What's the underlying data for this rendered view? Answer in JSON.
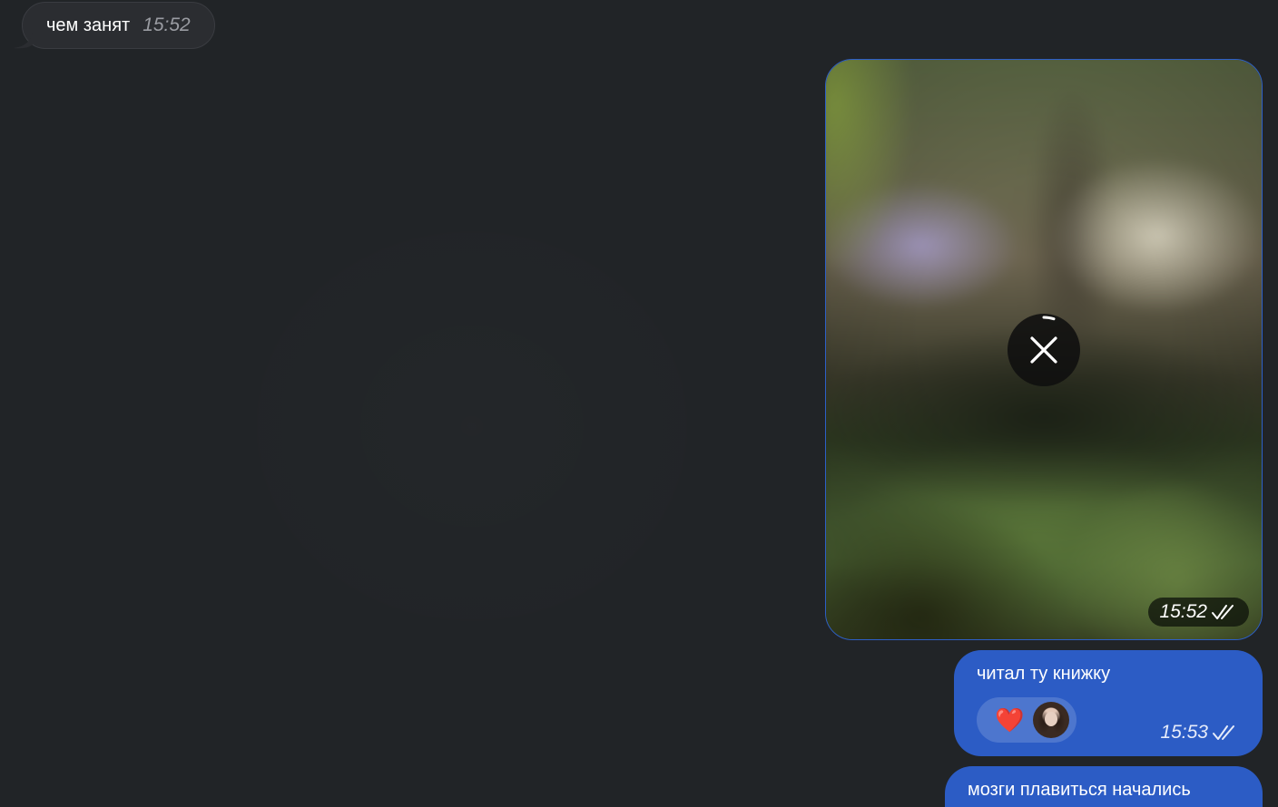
{
  "colors": {
    "background": "#212427",
    "incoming_bubble": "#2b2d31",
    "outgoing_bubble": "#2c5cc5"
  },
  "messages": {
    "incoming": {
      "text": "чем занят",
      "time": "15:52"
    },
    "media": {
      "time": "15:52",
      "status_icon": "double-check-icon",
      "cancel_icon": "close-icon"
    },
    "outgoing_1": {
      "text": "читал ту книжку",
      "time": "15:53",
      "reaction_emoji": "❤️",
      "status_icon": "double-check-icon"
    },
    "outgoing_2": {
      "text": "мозги плавиться начались"
    }
  }
}
